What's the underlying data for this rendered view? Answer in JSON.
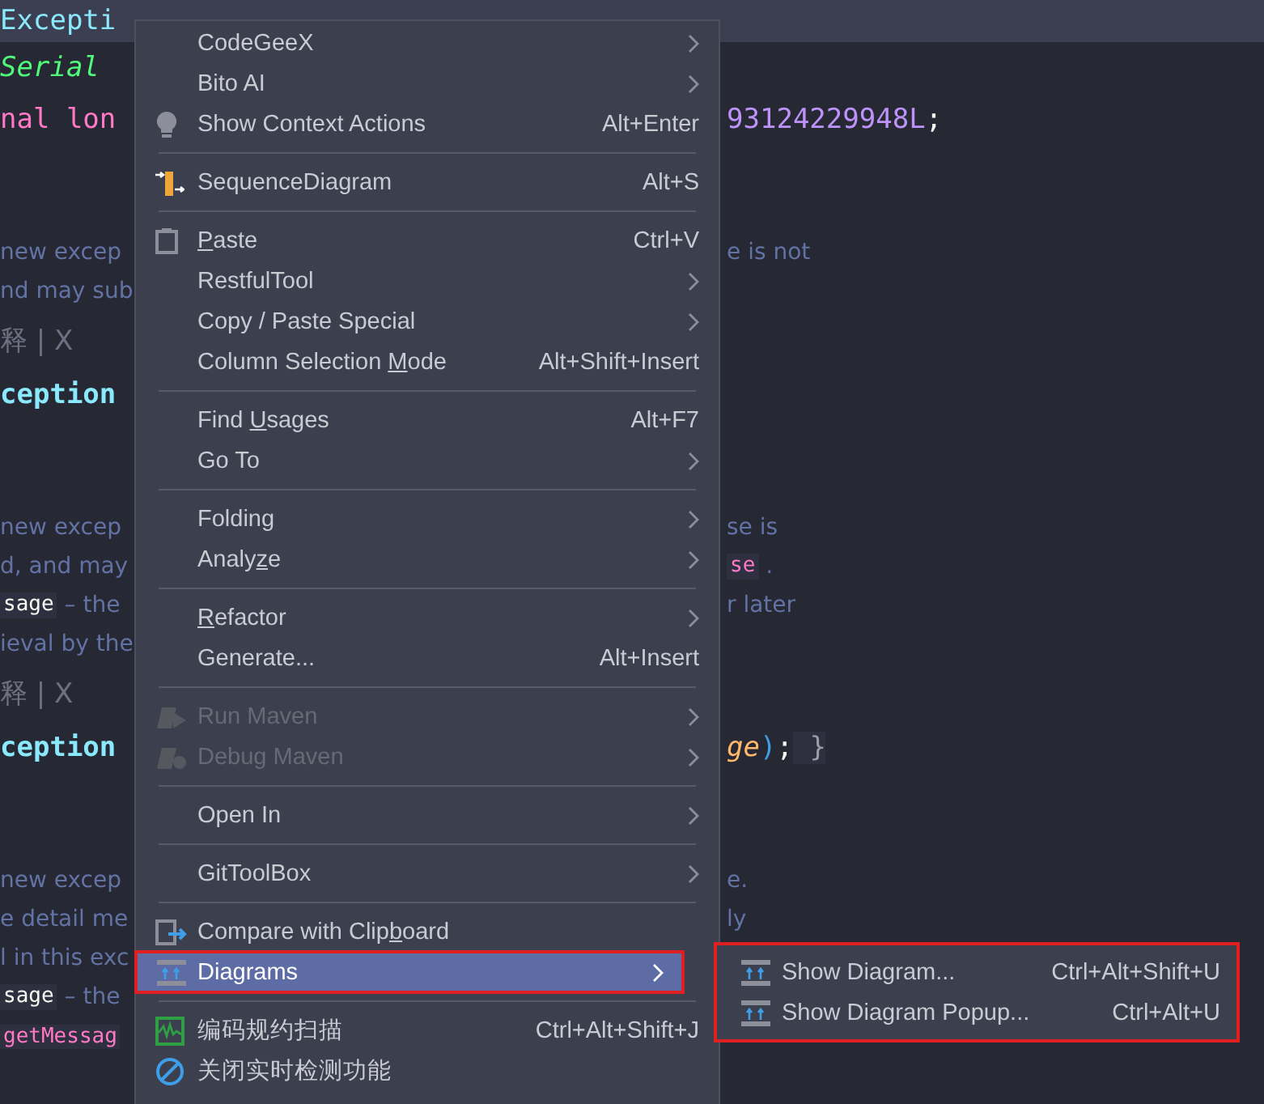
{
  "editor": {
    "rows": [
      {
        "kind": "tab",
        "left": [
          {
            "text": "Excepti",
            "kind": "type"
          }
        ]
      },
      {
        "kind": "code",
        "left": [
          {
            "text": "Serial",
            "kind": "annotation"
          }
        ]
      },
      {
        "kind": "code",
        "left": [
          {
            "text": "nal lon",
            "kind": "keyword"
          }
        ],
        "right": [
          {
            "text": "93124229948L",
            "kind": "number"
          },
          {
            "text": ";",
            "kind": "punct"
          }
        ]
      },
      {
        "kind": "blank"
      },
      {
        "kind": "doc",
        "left": [
          {
            "text": "new excep",
            "kind": "doc"
          }
        ],
        "right": [
          {
            "text": "e is not",
            "kind": "doc"
          }
        ]
      },
      {
        "kind": "doc",
        "left": [
          {
            "text": "nd may sub",
            "kind": "doc"
          }
        ]
      },
      {
        "kind": "inlay",
        "left": [
          {
            "text": "释 | X",
            "kind": "hint"
          }
        ]
      },
      {
        "kind": "code",
        "left": [
          {
            "text": "ception",
            "kind": "type"
          }
        ]
      },
      {
        "kind": "blank"
      },
      {
        "kind": "doc",
        "left": [
          {
            "text": "new excep",
            "kind": "doc"
          }
        ],
        "right": [
          {
            "text": "se is",
            "kind": "doc"
          }
        ]
      },
      {
        "kind": "doc",
        "left": [
          {
            "text": "d, and may",
            "kind": "doc"
          }
        ],
        "right": [
          {
            "text": "se",
            "kind": "codepink"
          },
          {
            "text": " .",
            "kind": "doc"
          }
        ]
      },
      {
        "kind": "doc",
        "left": [
          {
            "text": "sage",
            "kind": "codewhite"
          },
          {
            "text": " – the",
            "kind": "doc"
          }
        ],
        "right": [
          {
            "text": "r later",
            "kind": "doc"
          }
        ]
      },
      {
        "kind": "doc",
        "left": [
          {
            "text": "ieval by the",
            "kind": "doc"
          }
        ]
      },
      {
        "kind": "inlay",
        "left": [
          {
            "text": "释 | X",
            "kind": "hint"
          }
        ]
      },
      {
        "kind": "code",
        "left": [
          {
            "text": "ception",
            "kind": "type"
          }
        ],
        "right": [
          {
            "text": "ge",
            "kind": "param"
          },
          {
            "text": ")",
            "kind": "paren"
          },
          {
            "text": ";",
            "kind": "punct"
          },
          {
            "text": " }",
            "kind": "fold"
          }
        ]
      },
      {
        "kind": "blank"
      },
      {
        "kind": "doc",
        "left": [
          {
            "text": "new excep",
            "kind": "doc"
          }
        ],
        "right": [
          {
            "text": "e.",
            "kind": "doc"
          }
        ]
      },
      {
        "kind": "doc",
        "left": [
          {
            "text": "e detail me",
            "kind": "doc"
          }
        ],
        "right": [
          {
            "text": "ly",
            "kind": "doc"
          }
        ]
      },
      {
        "kind": "doc",
        "left": [
          {
            "text": "l in this exc",
            "kind": "doc"
          }
        ]
      },
      {
        "kind": "doc",
        "left": [
          {
            "text": "sage",
            "kind": "codewhite"
          },
          {
            "text": " – the",
            "kind": "doc"
          }
        ]
      },
      {
        "kind": "doc",
        "left": [
          {
            "text": "getMessag",
            "kind": "codepink"
          }
        ]
      }
    ]
  },
  "context_menu": {
    "items": [
      {
        "kind": "plain",
        "label": [
          {
            "text": "CodeGeeX",
            "underlined": false
          }
        ],
        "submenu": true,
        "disabled": false,
        "selected": false
      },
      {
        "kind": "plain",
        "label": [
          {
            "text": "Bito AI",
            "underlined": false
          }
        ],
        "submenu": true,
        "disabled": false,
        "selected": false
      },
      {
        "kind": "bulb",
        "label": [
          {
            "text": "Show Context Actions",
            "underlined": false
          }
        ],
        "shortcut": "Alt+Enter",
        "submenu": false,
        "disabled": false,
        "selected": false
      },
      {
        "kind": "separator"
      },
      {
        "kind": "sequence",
        "label": [
          {
            "text": "SequenceDiagram",
            "underlined": false
          }
        ],
        "shortcut": "Alt+S",
        "submenu": false,
        "disabled": false,
        "selected": false
      },
      {
        "kind": "separator"
      },
      {
        "kind": "clipboard",
        "label": [
          {
            "text": "P",
            "underlined": true
          },
          {
            "text": "aste",
            "underlined": false
          }
        ],
        "shortcut": "Ctrl+V",
        "submenu": false,
        "disabled": false,
        "selected": false
      },
      {
        "kind": "plain",
        "label": [
          {
            "text": "RestfulTool",
            "underlined": false
          }
        ],
        "submenu": true,
        "disabled": false,
        "selected": false
      },
      {
        "kind": "plain",
        "label": [
          {
            "text": "Copy / Paste Special",
            "underlined": false
          }
        ],
        "submenu": true,
        "disabled": false,
        "selected": false
      },
      {
        "kind": "plain",
        "label": [
          {
            "text": "Column Selection ",
            "underlined": false
          },
          {
            "text": "M",
            "underlined": true
          },
          {
            "text": "ode",
            "underlined": false
          }
        ],
        "shortcut": "Alt+Shift+Insert",
        "submenu": false,
        "disabled": false,
        "selected": false
      },
      {
        "kind": "separator"
      },
      {
        "kind": "plain",
        "label": [
          {
            "text": "Find ",
            "underlined": false
          },
          {
            "text": "U",
            "underlined": true
          },
          {
            "text": "sages",
            "underlined": false
          }
        ],
        "shortcut": "Alt+F7",
        "submenu": false,
        "disabled": false,
        "selected": false
      },
      {
        "kind": "plain",
        "label": [
          {
            "text": "Go To",
            "underlined": false
          }
        ],
        "submenu": true,
        "disabled": false,
        "selected": false
      },
      {
        "kind": "separator"
      },
      {
        "kind": "plain",
        "label": [
          {
            "text": "Folding",
            "underlined": false
          }
        ],
        "submenu": true,
        "disabled": false,
        "selected": false
      },
      {
        "kind": "plain",
        "label": [
          {
            "text": "Analy",
            "underlined": false
          },
          {
            "text": "z",
            "underlined": true
          },
          {
            "text": "e",
            "underlined": false
          }
        ],
        "submenu": true,
        "disabled": false,
        "selected": false
      },
      {
        "kind": "separator"
      },
      {
        "kind": "plain",
        "label": [
          {
            "text": "R",
            "underlined": true
          },
          {
            "text": "efactor",
            "underlined": false
          }
        ],
        "submenu": true,
        "disabled": false,
        "selected": false
      },
      {
        "kind": "plain",
        "label": [
          {
            "text": "Generate...",
            "underlined": false
          }
        ],
        "shortcut": "Alt+Insert",
        "submenu": false,
        "disabled": false,
        "selected": false
      },
      {
        "kind": "separator"
      },
      {
        "kind": "mavenrun",
        "label": [
          {
            "text": "Run Maven",
            "underlined": false
          }
        ],
        "submenu": true,
        "disabled": true,
        "selected": false
      },
      {
        "kind": "mavendebug",
        "label": [
          {
            "text": "Debug Maven",
            "underlined": false
          }
        ],
        "submenu": true,
        "disabled": true,
        "selected": false
      },
      {
        "kind": "separator"
      },
      {
        "kind": "plain",
        "label": [
          {
            "text": "Open In",
            "underlined": false
          }
        ],
        "submenu": true,
        "disabled": false,
        "selected": false
      },
      {
        "kind": "separator"
      },
      {
        "kind": "plain",
        "label": [
          {
            "text": "GitToolBox",
            "underlined": false
          }
        ],
        "submenu": true,
        "disabled": false,
        "selected": false
      },
      {
        "kind": "separator"
      },
      {
        "kind": "compare",
        "label": [
          {
            "text": "Compare with Clip",
            "underlined": false
          },
          {
            "text": "b",
            "underlined": true
          },
          {
            "text": "oard",
            "underlined": false
          }
        ],
        "submenu": false,
        "disabled": false,
        "selected": false
      },
      {
        "kind": "diagram",
        "label": [
          {
            "text": "Diagrams",
            "underlined": false
          }
        ],
        "submenu": true,
        "disabled": false,
        "selected": true,
        "annotated": true
      },
      {
        "kind": "separator"
      },
      {
        "kind": "scan",
        "label": [
          {
            "text": "编码规约扫描",
            "underlined": false
          }
        ],
        "shortcut": "Ctrl+Alt+Shift+J",
        "submenu": false,
        "disabled": false,
        "selected": false
      },
      {
        "kind": "ban",
        "label": [
          {
            "text": "关闭实时检测功能",
            "underlined": false
          }
        ],
        "submenu": false,
        "disabled": false,
        "selected": false
      }
    ]
  },
  "submenu": {
    "annotated": true,
    "items": [
      {
        "kind": "diagram",
        "label": "Show Diagram...",
        "shortcut": "Ctrl+Alt+Shift+U"
      },
      {
        "kind": "diagram",
        "label": "Show Diagram Popup...",
        "shortcut": "Ctrl+Alt+U"
      }
    ]
  }
}
